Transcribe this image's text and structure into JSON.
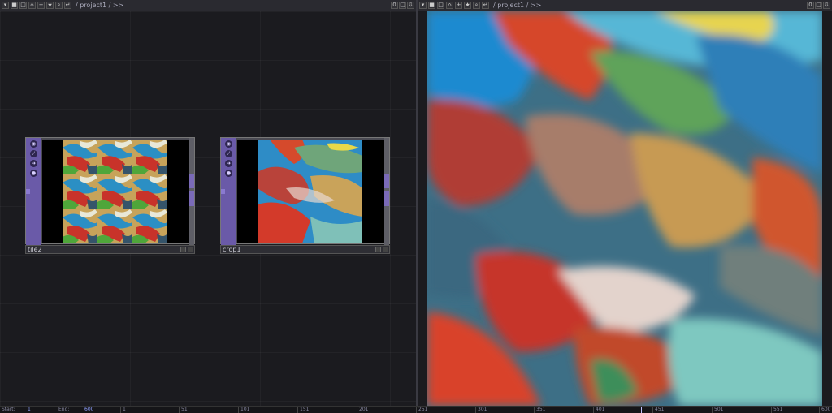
{
  "left_pane": {
    "breadcrumb": "/ project1 / >>",
    "right_buttons": [
      "0",
      "□",
      "⇩"
    ],
    "nodes": [
      {
        "name": "tile2"
      },
      {
        "name": "crop1"
      }
    ]
  },
  "right_pane": {
    "breadcrumb": "/ project1 / >>",
    "right_buttons": [
      "0",
      "□",
      "⇩"
    ]
  },
  "timeline": {
    "start_label": "Start:",
    "start_value": "1",
    "end_label": "End:",
    "end_value": "600",
    "ticks": [
      "1",
      "51",
      "101",
      "151",
      "201",
      "251",
      "301",
      "351",
      "401",
      "451",
      "501",
      "551",
      "600"
    ]
  },
  "colors": {
    "operator_purple": "#6a5aa8",
    "wire": "#7a6ab8",
    "background": "#1b1b1f"
  }
}
